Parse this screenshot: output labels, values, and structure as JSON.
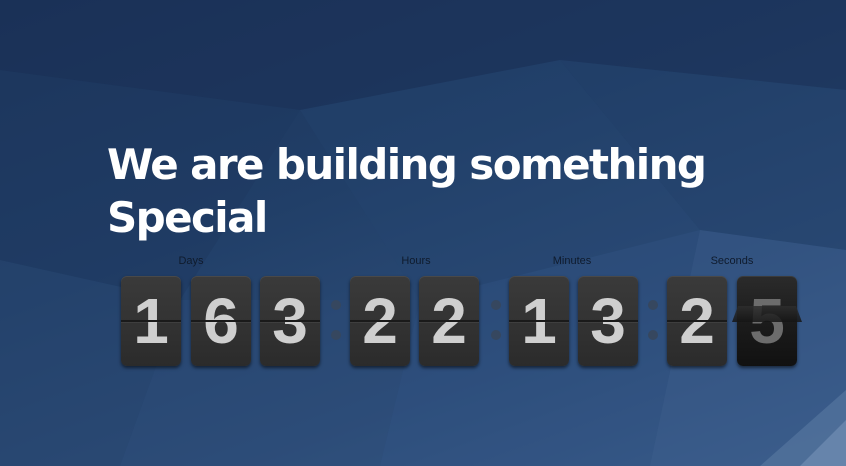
{
  "headline": {
    "line1": "We are building something",
    "line2": "Special"
  },
  "countdown": {
    "labels": {
      "days": "Days",
      "hours": "Hours",
      "minutes": "Minutes",
      "seconds": "Seconds"
    },
    "days": [
      "1",
      "6",
      "3"
    ],
    "hours": [
      "2",
      "2"
    ],
    "minutes": [
      "1",
      "3"
    ],
    "seconds": [
      "2",
      "5"
    ]
  }
}
